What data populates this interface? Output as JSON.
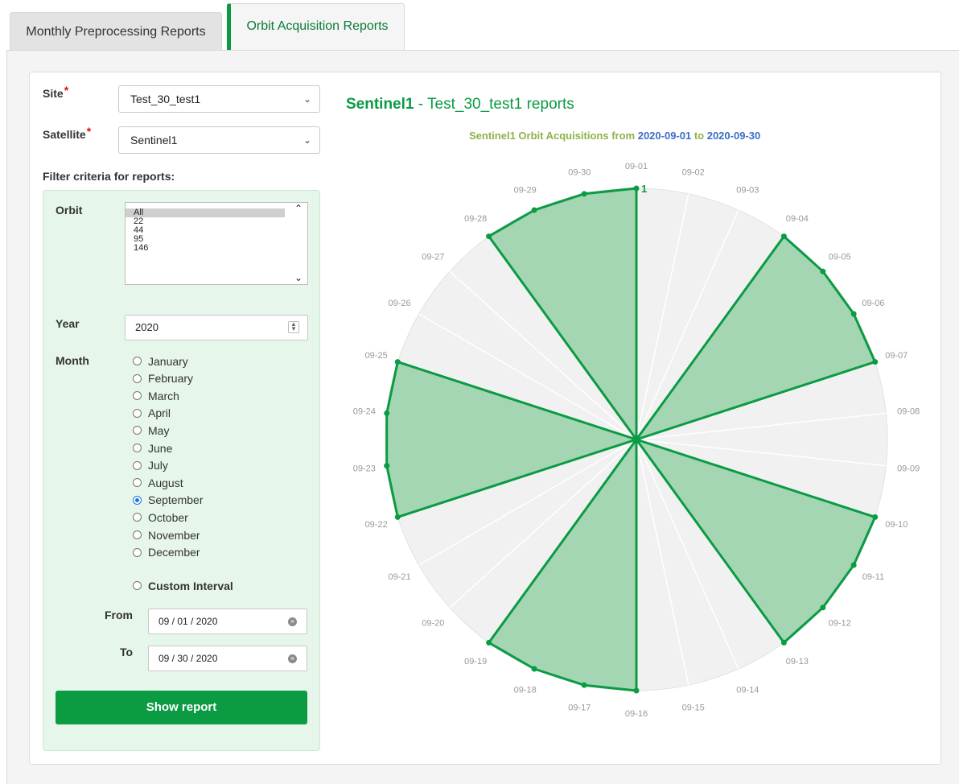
{
  "tabs": [
    {
      "label": "Monthly Preprocessing Reports"
    },
    {
      "label": "Orbit Acquisition Reports"
    }
  ],
  "form": {
    "site_label": "Site",
    "site_value": "Test_30_test1",
    "satellite_label": "Satellite",
    "satellite_value": "Sentinel1",
    "required_mark": "*",
    "filter_heading": "Filter criteria for reports:",
    "orbit_label": "Orbit",
    "orbit_options": [
      "All",
      "22",
      "44",
      "95",
      "146"
    ],
    "orbit_selected": "All",
    "year_label": "Year",
    "year_value": "2020",
    "month_label": "Month",
    "months": [
      "January",
      "February",
      "March",
      "April",
      "May",
      "June",
      "July",
      "August",
      "September",
      "October",
      "November",
      "December"
    ],
    "selected_month": "September",
    "custom_interval_label": "Custom Interval",
    "from_label": "From",
    "from_value": "09 / 01 / 2020",
    "to_label": "To",
    "to_value": "09 / 30 / 2020",
    "show_report_label": "Show report"
  },
  "report": {
    "title_bold": "Sentinel1",
    "title_rest": " - Test_30_test1 reports",
    "subtitle_prefix": "Sentinel1 Orbit Acquisitions from ",
    "date_from": "2020-09-01",
    "subtitle_mid": " to ",
    "date_to": "2020-09-30"
  },
  "colors": {
    "accent": "#0a9b43",
    "area_fill": "#9fd4b0",
    "subtitle": "#8db34a",
    "date": "#3a6fc4"
  },
  "chart_data": {
    "type": "radar",
    "categories": [
      "09-01",
      "09-02",
      "09-03",
      "09-04",
      "09-05",
      "09-06",
      "09-07",
      "09-08",
      "09-09",
      "09-10",
      "09-11",
      "09-12",
      "09-13",
      "09-14",
      "09-15",
      "09-16",
      "09-17",
      "09-18",
      "09-19",
      "09-20",
      "09-21",
      "09-22",
      "09-23",
      "09-24",
      "09-25",
      "09-26",
      "09-27",
      "09-28",
      "09-29",
      "09-30"
    ],
    "values": [
      1,
      0,
      0,
      1,
      1,
      1,
      1,
      0,
      0,
      1,
      1,
      1,
      1,
      0,
      0,
      1,
      1,
      1,
      1,
      0,
      0,
      1,
      1,
      1,
      1,
      0,
      0,
      1,
      1,
      1
    ],
    "max": 1,
    "tick_label": "1"
  }
}
